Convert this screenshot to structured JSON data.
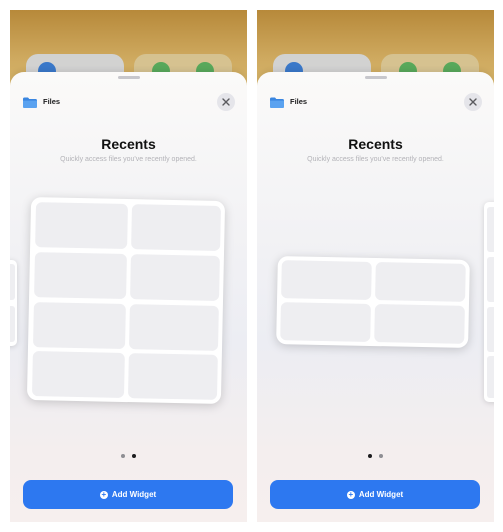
{
  "screens": [
    {
      "app_name": "Files",
      "title": "Recents",
      "subtitle": "Quickly access files you've recently opened.",
      "add_button_label": "Add Widget",
      "page_indicator": {
        "count": 2,
        "active_index": 1
      },
      "widget_size": "large"
    },
    {
      "app_name": "Files",
      "title": "Recents",
      "subtitle": "Quickly access files you've recently opened.",
      "add_button_label": "Add Widget",
      "page_indicator": {
        "count": 2,
        "active_index": 0
      },
      "widget_size": "medium"
    }
  ],
  "icons": {
    "app_icon": "folder-icon",
    "close": "close-icon",
    "add": "plus-circle-icon"
  },
  "colors": {
    "accent": "#2d78f0",
    "folder": "#4a90e2",
    "wallpaper": "#c9a45a"
  }
}
